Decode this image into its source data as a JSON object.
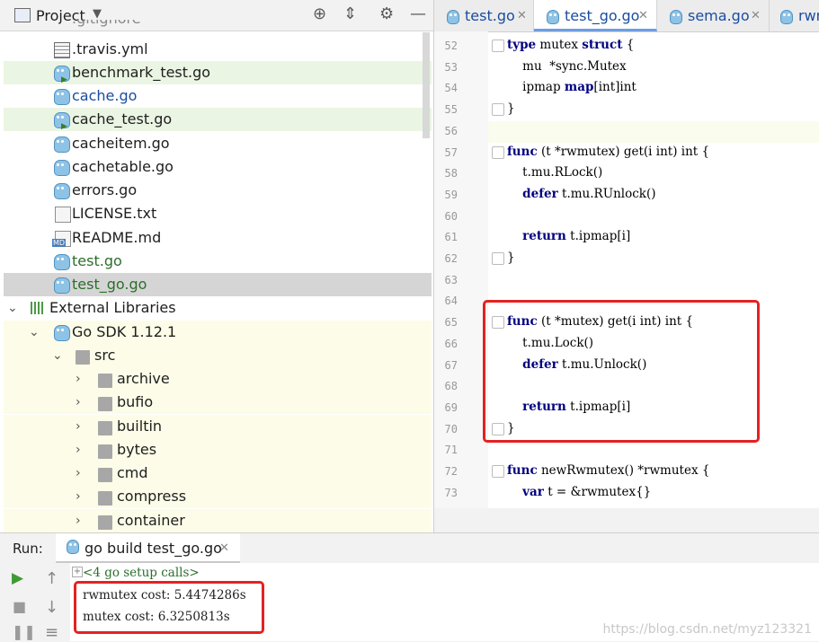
{
  "project": {
    "title": "Project",
    "files": [
      {
        "name": ".gitignore",
        "kind": "file",
        "style": "plain"
      },
      {
        "name": ".travis.yml",
        "kind": "table",
        "style": "plain"
      },
      {
        "name": "benchmark_test.go",
        "kind": "go-test",
        "style": "green"
      },
      {
        "name": "cache.go",
        "kind": "go",
        "style": "link"
      },
      {
        "name": "cache_test.go",
        "kind": "go-test",
        "style": "green"
      },
      {
        "name": "cacheitem.go",
        "kind": "go",
        "style": "plain"
      },
      {
        "name": "cachetable.go",
        "kind": "go",
        "style": "plain"
      },
      {
        "name": "errors.go",
        "kind": "go",
        "style": "plain"
      },
      {
        "name": "LICENSE.txt",
        "kind": "file",
        "style": "plain"
      },
      {
        "name": "README.md",
        "kind": "md",
        "style": "plain"
      },
      {
        "name": "test.go",
        "kind": "go",
        "style": "gtxt"
      },
      {
        "name": "test_go.go",
        "kind": "go",
        "style": "selected"
      }
    ],
    "external_libraries": "External Libraries",
    "sdk": "Go SDK 1.12.1",
    "src": "src",
    "folders": [
      "archive",
      "bufio",
      "builtin",
      "bytes",
      "cmd",
      "compress",
      "container"
    ]
  },
  "editor": {
    "tabs": [
      {
        "label": "test.go",
        "active": false
      },
      {
        "label": "test_go.go",
        "active": true
      },
      {
        "label": "sema.go",
        "active": false
      },
      {
        "label": "rwm",
        "active": false
      }
    ],
    "lines": [
      {
        "n": "52",
        "text": "type mutex struct {"
      },
      {
        "n": "53",
        "text": "    mu  *sync.Mutex"
      },
      {
        "n": "54",
        "text": "    ipmap map[int]int"
      },
      {
        "n": "55",
        "text": "}"
      },
      {
        "n": "56",
        "text": ""
      },
      {
        "n": "57",
        "text": "func (t *rwmutex) get(i int) int {"
      },
      {
        "n": "58",
        "text": "    t.mu.RLock()"
      },
      {
        "n": "59",
        "text": "    defer t.mu.RUnlock()"
      },
      {
        "n": "60",
        "text": ""
      },
      {
        "n": "61",
        "text": "    return t.ipmap[i]"
      },
      {
        "n": "62",
        "text": "}"
      },
      {
        "n": "63",
        "text": ""
      },
      {
        "n": "64",
        "text": ""
      },
      {
        "n": "65",
        "text": "func (t *mutex) get(i int) int {"
      },
      {
        "n": "66",
        "text": "    t.mu.Lock()"
      },
      {
        "n": "67",
        "text": "    defer t.mu.Unlock()"
      },
      {
        "n": "68",
        "text": ""
      },
      {
        "n": "69",
        "text": "    return t.ipmap[i]"
      },
      {
        "n": "70",
        "text": "}"
      },
      {
        "n": "71",
        "text": ""
      },
      {
        "n": "72",
        "text": "func newRwmutex() *rwmutex {"
      },
      {
        "n": "73",
        "text": "    var t = &rwmutex{}"
      }
    ]
  },
  "run": {
    "label": "Run:",
    "tab": "go build test_go.go",
    "setup": "<4 go setup calls>",
    "output": [
      "rwmutex cost: 5.4474286s",
      "mutex cost: 6.3250813s"
    ]
  },
  "watermark": "https://blog.csdn.net/myz123321",
  "colors": {
    "highlight_box": "#e32222",
    "go_icon": "#8ec3e6",
    "test_bg": "#ebf5e3"
  }
}
